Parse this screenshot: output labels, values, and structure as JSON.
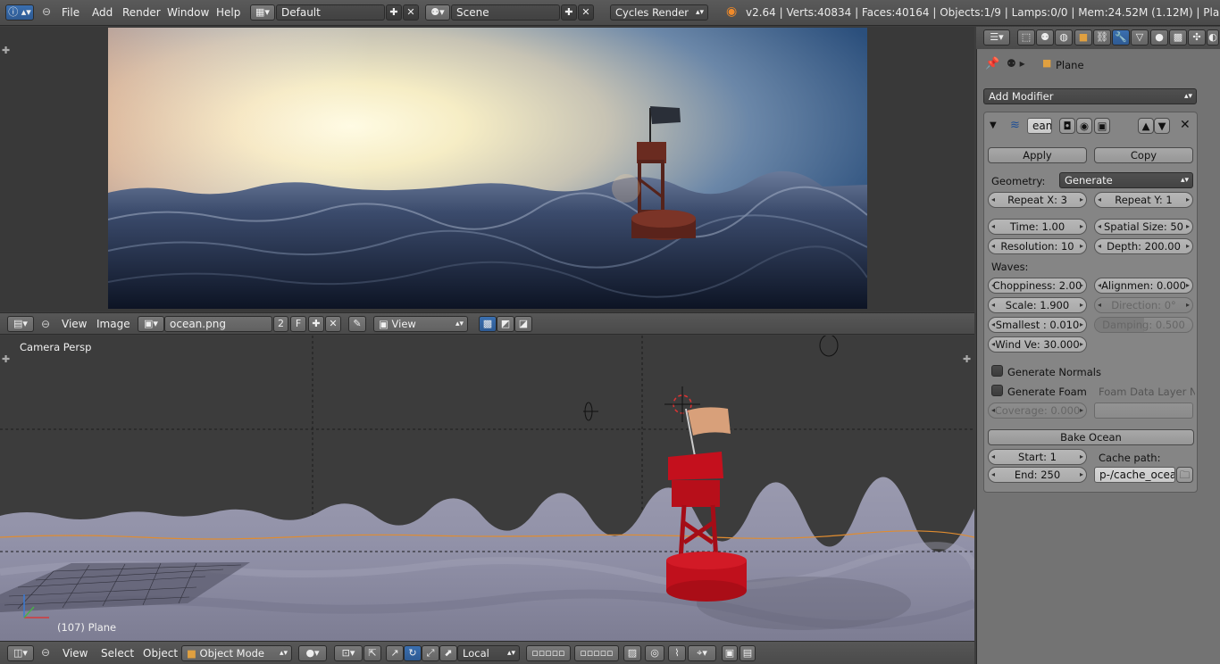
{
  "topbar": {
    "menus": [
      "File",
      "Add",
      "Render",
      "Window",
      "Help"
    ],
    "layout": "Default",
    "scene": "Scene",
    "engine": "Cycles Render",
    "info": "v2.64 | Verts:40834 | Faces:40164 | Objects:1/9 | Lamps:0/0 | Mem:24.52M (1.12M) | Plane"
  },
  "image_editor": {
    "menus": [
      "View",
      "Image"
    ],
    "image_name": "ocean.png",
    "users": "2",
    "fake_user": "F",
    "view_mode": "View"
  },
  "viewport": {
    "label": "Camera Persp",
    "object_label": "(107) Plane",
    "menus": [
      "View",
      "Select",
      "Object"
    ],
    "mode": "Object Mode",
    "orientation": "Local"
  },
  "properties": {
    "breadcrumb_object": "Plane",
    "add_modifier": "Add Modifier",
    "modifier_name": "ean",
    "apply": "Apply",
    "copy": "Copy",
    "geometry_label": "Geometry:",
    "geometry_value": "Generate",
    "repeat_x": "Repeat X: 3",
    "repeat_y": "Repeat Y: 1",
    "time": "Time: 1.00",
    "spatial_size": "Spatial Size: 50",
    "resolution": "Resolution: 10",
    "depth": "Depth: 200.00",
    "waves_label": "Waves:",
    "choppiness": "Choppiness: 2.00",
    "alignment": "Alignmen: 0.000",
    "scale": "Scale: 1.900",
    "direction": "Direction: 0°",
    "smallest": "Smallest : 0.010",
    "damping": "Damping: 0.500",
    "wind_velocity": "Wind Ve: 30.000",
    "generate_normals": "Generate Normals",
    "generate_foam": "Generate Foam",
    "foam_layer": "Foam Data Layer Na",
    "coverage": "Coverage: 0.000",
    "bake_ocean": "Bake Ocean",
    "start": "Start: 1",
    "end": "End: 250",
    "cache_path_label": "Cache path:",
    "cache_path": "p-/cache_ocean"
  }
}
